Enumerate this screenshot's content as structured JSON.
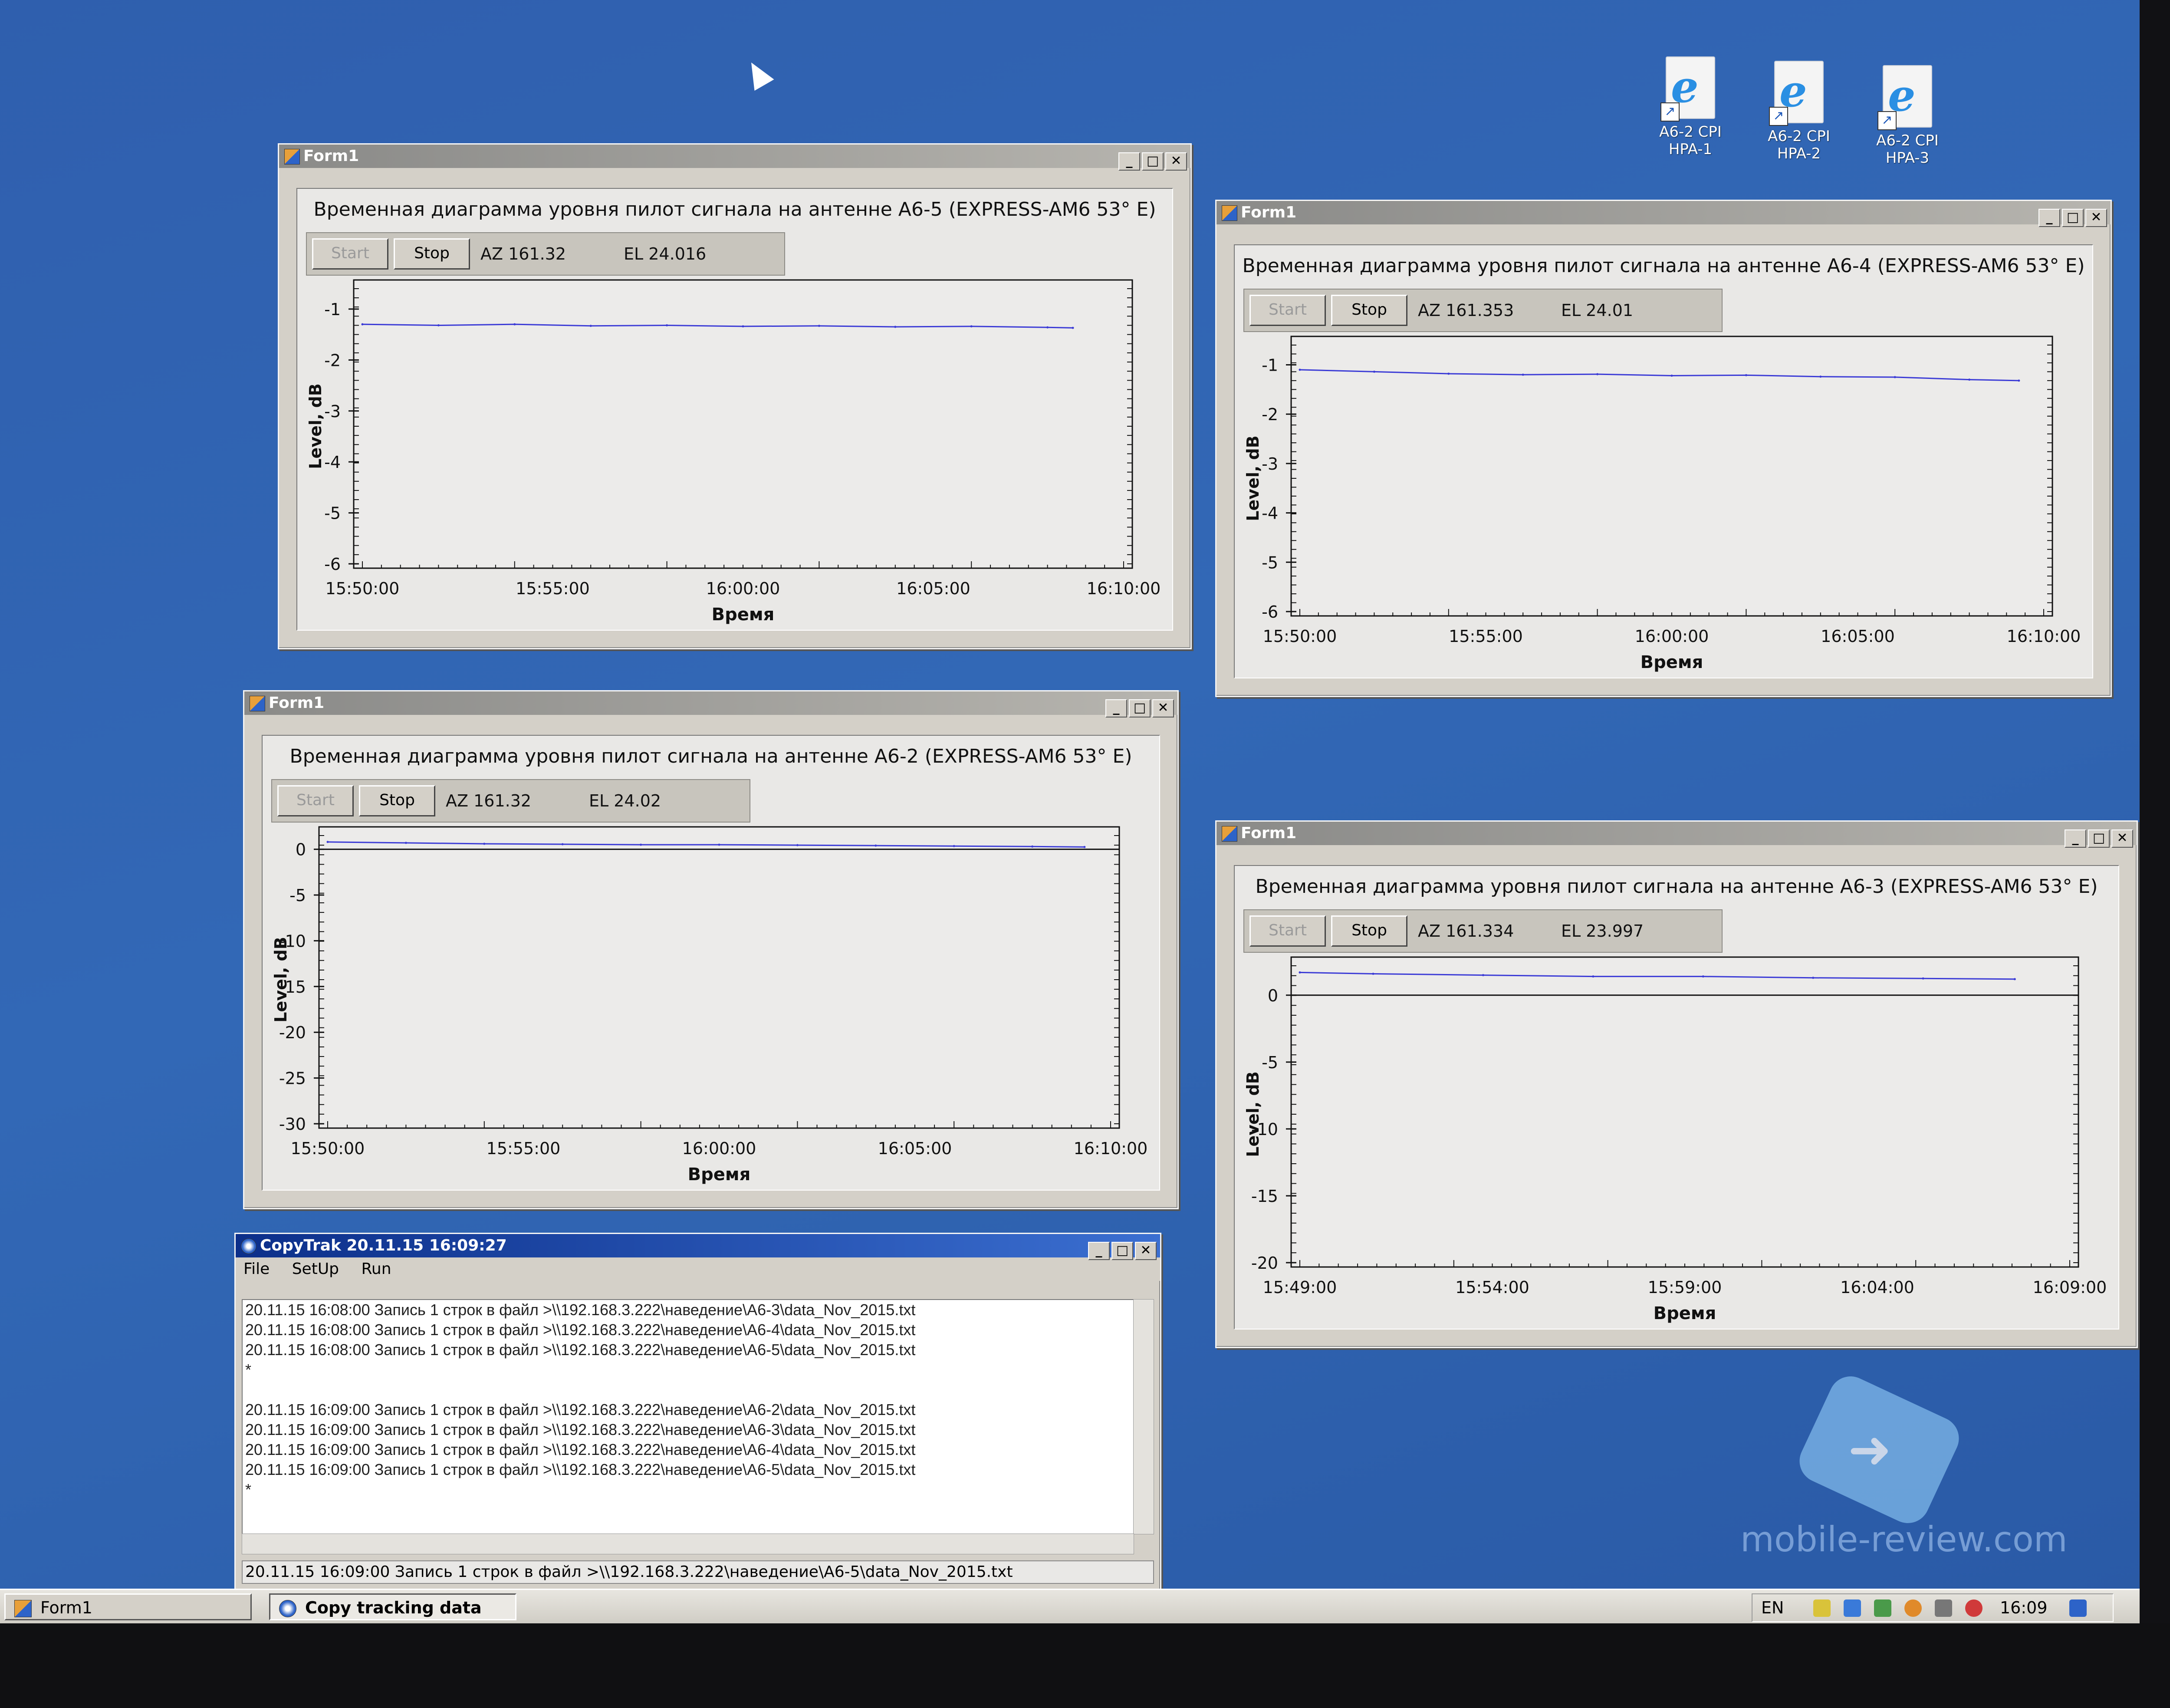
{
  "desktop_icons": [
    {
      "label_line1": "A6-2 CPI",
      "label_line2": "HPA-1"
    },
    {
      "label_line1": "A6-2 CPI",
      "label_line2": "HPA-2"
    },
    {
      "label_line1": "A6-2 CPI",
      "label_line2": "HPA-3"
    }
  ],
  "windows": [
    {
      "title": "Form1",
      "chart_title": "Временная диаграмма уровня пилот сигнала на антенне А6-5 (EXPRESS-AM6 53° E)",
      "start_label": "Start",
      "stop_label": "Stop",
      "az": "AZ  161.32",
      "el": "EL  24.016"
    },
    {
      "title": "Form1",
      "chart_title": "Временная диаграмма уровня пилот сигнала на антенне А6-4 (EXPRESS-AM6 53° E)",
      "start_label": "Start",
      "stop_label": "Stop",
      "az": "AZ  161.353",
      "el": "EL  24.01"
    },
    {
      "title": "Form1",
      "chart_title": "Временная диаграмма уровня пилот сигнала на антенне А6-2 (EXPRESS-AM6 53° E)",
      "start_label": "Start",
      "stop_label": "Stop",
      "az": "AZ  161.32",
      "el": "EL  24.02"
    },
    {
      "title": "Form1",
      "chart_title": "Временная диаграмма уровня пилот сигнала на антенне А6-3 (EXPRESS-AM6 53° E)",
      "start_label": "Start",
      "stop_label": "Stop",
      "az": "AZ  161.334",
      "el": "EL  23.997"
    }
  ],
  "chart_data": [
    {
      "type": "line",
      "xlabel": "Время",
      "ylabel": "Level, dB",
      "x_ticks": [
        "15:50:00",
        "15:55:00",
        "16:00:00",
        "16:05:00",
        "16:10:00"
      ],
      "y_ticks": [
        -1,
        -2,
        -3,
        -4,
        -5,
        -6
      ],
      "ylim": [
        -6,
        -0.6
      ],
      "xlim": [
        "15:50:00",
        "16:10:00"
      ],
      "series": [
        {
          "color": "#3b3bd6",
          "x": [
            "15:50:00",
            "15:52:00",
            "15:54:00",
            "15:56:00",
            "15:58:00",
            "16:00:00",
            "16:02:00",
            "16:04:00",
            "16:06:00",
            "16:08:00",
            "16:08:40"
          ],
          "y": [
            -1.3,
            -1.32,
            -1.3,
            -1.33,
            -1.32,
            -1.34,
            -1.33,
            -1.35,
            -1.34,
            -1.36,
            -1.37
          ]
        }
      ]
    },
    {
      "type": "line",
      "xlabel": "Время",
      "ylabel": "Level, dB",
      "x_ticks": [
        "15:50:00",
        "15:55:00",
        "16:00:00",
        "16:05:00",
        "16:10:00"
      ],
      "y_ticks": [
        -1,
        -2,
        -3,
        -4,
        -5,
        -6
      ],
      "ylim": [
        -6,
        -0.6
      ],
      "xlim": [
        "15:50:00",
        "16:10:00"
      ],
      "series": [
        {
          "color": "#3b3bd6",
          "x": [
            "15:50:00",
            "15:52:00",
            "15:54:00",
            "15:56:00",
            "15:58:00",
            "16:00:00",
            "16:02:00",
            "16:04:00",
            "16:06:00",
            "16:08:00",
            "16:09:20"
          ],
          "y": [
            -1.1,
            -1.14,
            -1.18,
            -1.2,
            -1.19,
            -1.22,
            -1.21,
            -1.24,
            -1.25,
            -1.3,
            -1.32
          ]
        }
      ]
    },
    {
      "type": "line",
      "xlabel": "Время",
      "ylabel": "Level, dB",
      "x_ticks": [
        "15:50:00",
        "15:55:00",
        "16:00:00",
        "16:05:00",
        "16:10:00"
      ],
      "y_ticks": [
        0,
        -5,
        -10,
        -15,
        -20,
        -25,
        -30
      ],
      "ylim": [
        -30,
        1.5
      ],
      "xlim": [
        "15:50:00",
        "16:10:00"
      ],
      "series": [
        {
          "color": "#3b3bd6",
          "x": [
            "15:50:00",
            "15:52:00",
            "15:54:00",
            "15:56:00",
            "15:58:00",
            "16:00:00",
            "16:02:00",
            "16:04:00",
            "16:06:00",
            "16:08:00",
            "16:09:20"
          ],
          "y": [
            0.8,
            0.7,
            0.6,
            0.55,
            0.5,
            0.5,
            0.45,
            0.4,
            0.35,
            0.3,
            0.25
          ]
        }
      ]
    },
    {
      "type": "line",
      "xlabel": "Время",
      "ylabel": "Level, dB",
      "x_ticks": [
        "15:49:00",
        "15:54:00",
        "15:59:00",
        "16:04:00",
        "16:09:00"
      ],
      "y_ticks": [
        0,
        -5,
        -10,
        -15,
        -20
      ],
      "ylim": [
        -20,
        2.2
      ],
      "xlim": [
        "15:49:00",
        "16:10:00"
      ],
      "series": [
        {
          "color": "#3b3bd6",
          "x": [
            "15:49:00",
            "15:51:00",
            "15:54:00",
            "15:57:00",
            "16:00:00",
            "16:03:00",
            "16:06:00",
            "16:08:30"
          ],
          "y": [
            1.7,
            1.6,
            1.5,
            1.4,
            1.4,
            1.3,
            1.25,
            1.2
          ]
        }
      ]
    }
  ],
  "copytrak": {
    "title": "CopyTrak 20.11.15 16:09:27",
    "menu": [
      "File",
      "SetUp",
      "Run"
    ],
    "log_lines": [
      "20.11.15 16:08:00 Запись 1 строк в файл >\\\\192.168.3.222\\наведение\\A6-3\\data_Nov_2015.txt",
      "20.11.15 16:08:00 Запись 1 строк в файл >\\\\192.168.3.222\\наведение\\A6-4\\data_Nov_2015.txt",
      "20.11.15 16:08:00 Запись 1 строк в файл >\\\\192.168.3.222\\наведение\\A6-5\\data_Nov_2015.txt",
      "*",
      "",
      "20.11.15 16:09:00 Запись 1 строк в файл >\\\\192.168.3.222\\наведение\\A6-2\\data_Nov_2015.txt",
      "20.11.15 16:09:00 Запись 1 строк в файл >\\\\192.168.3.222\\наведение\\A6-3\\data_Nov_2015.txt",
      "20.11.15 16:09:00 Запись 1 строк в файл >\\\\192.168.3.222\\наведение\\A6-4\\data_Nov_2015.txt",
      "20.11.15 16:09:00 Запись 1 строк в файл >\\\\192.168.3.222\\наведение\\A6-5\\data_Nov_2015.txt",
      "*"
    ],
    "status": "20.11.15 16:09:00 Запись 1 строк в файл >\\\\192.168.3.222\\наведение\\A6-5\\data_Nov_2015.txt"
  },
  "taskbar": {
    "tasks": [
      "Form1",
      "Copy tracking data"
    ],
    "lang": "EN",
    "clock": "16:09"
  },
  "watermark": "mobile-review.com",
  "colors": {
    "desktop": "#3064b2",
    "series": "#3b3bd6",
    "titlebar_active": "#0c2f8a"
  }
}
